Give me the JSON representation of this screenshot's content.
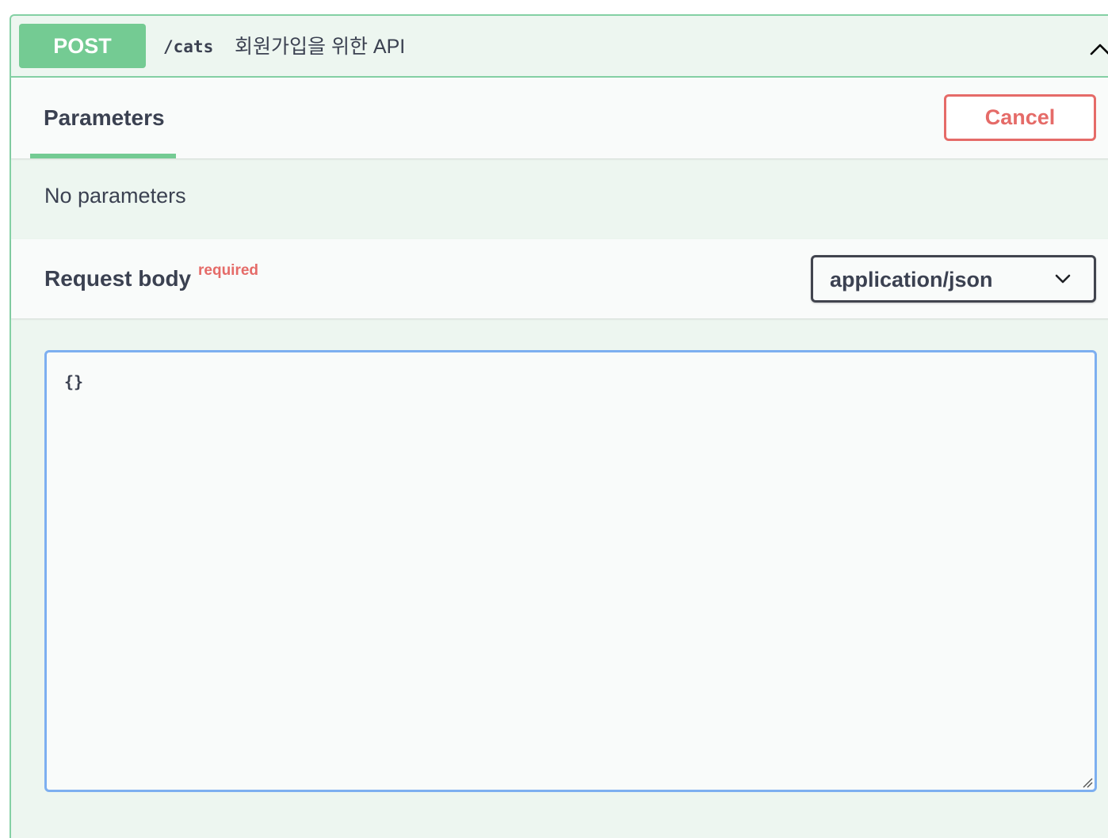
{
  "summary": {
    "method": "POST",
    "path": "/cats",
    "description": "회원가입을 위한 API",
    "collapse_icon": "chevron-up-icon"
  },
  "tabs": {
    "parameters_label": "Parameters"
  },
  "actions": {
    "cancel_label": "Cancel"
  },
  "parameters": {
    "empty_text": "No parameters"
  },
  "request_body": {
    "title": "Request body",
    "required_label": "required",
    "content_type": "application/json",
    "editor_value": "{}"
  },
  "colors": {
    "post_green": "#74cb93",
    "border_green": "#84d0a4",
    "cancel_red": "#e56b68",
    "editor_focus_blue": "#7daff0",
    "text_dark": "#3b4151"
  }
}
